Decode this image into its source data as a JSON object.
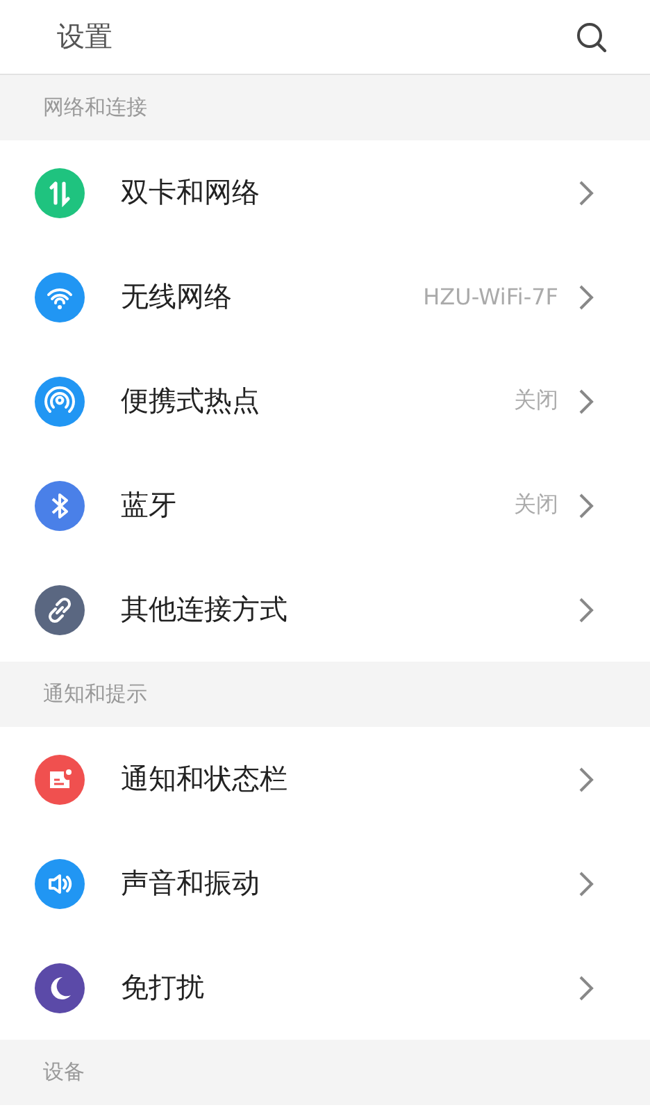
{
  "header": {
    "title": "设置"
  },
  "sections": [
    {
      "title": "网络和连接",
      "items": [
        {
          "kind": "updown",
          "color": "#1fc37f",
          "label": "双卡和网络"
        },
        {
          "kind": "wifi",
          "color": "#2196f3",
          "label": "无线网络",
          "value": "HZU-WiFi-7F"
        },
        {
          "kind": "hotspot",
          "color": "#2196f3",
          "label": "便携式热点",
          "value": "关闭"
        },
        {
          "kind": "bluetooth",
          "color": "#4a80e8",
          "label": "蓝牙",
          "value": "关闭"
        },
        {
          "kind": "link",
          "color": "#5a6781",
          "label": "其他连接方式"
        }
      ]
    },
    {
      "title": "通知和提示",
      "items": [
        {
          "kind": "notice",
          "color": "#f0504f",
          "label": "通知和状态栏"
        },
        {
          "kind": "sound",
          "color": "#2196f3",
          "label": "声音和振动"
        },
        {
          "kind": "moon",
          "color": "#5b4aa8",
          "label": "免打扰"
        }
      ]
    },
    {
      "title": "设备"
    }
  ]
}
